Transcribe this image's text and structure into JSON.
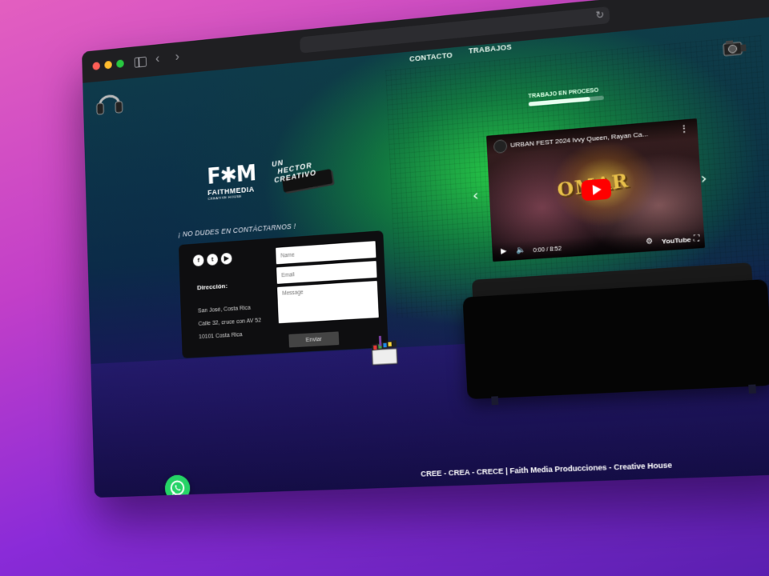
{
  "nav": {
    "contact": "CONTACTO",
    "works": "TRABAJOS"
  },
  "wip": {
    "label": "TRABAJO EN PROCESO",
    "progress": 0.82
  },
  "logos": {
    "faith_mark": "F✱M",
    "faith_name": "FAITHMEDIA",
    "faith_sub": "CREATIVE HOUSE",
    "hector": [
      "UN",
      "HECTOR",
      "CREATIVO"
    ]
  },
  "contact": {
    "heading": "¡ NO DUDES EN CONTÁCTARNOS !",
    "address_title": "Dirección:",
    "address_lines": [
      "San José, Costa Rica",
      "Calle 32, cruce con AV 52",
      "10101 Costa Rica"
    ],
    "name_placeholder": "Name",
    "email_placeholder": "Email",
    "message_placeholder": "Message",
    "send_label": "Enviar"
  },
  "social": {
    "facebook": "f",
    "twitter": "t",
    "youtube": "▶"
  },
  "video": {
    "title": "URBAN FEST 2024 Ivvy Queen, Rayan Ca...",
    "overlay": "OMAR",
    "time": "0:00 / 8:52",
    "brand": "YouTube"
  },
  "footer": {
    "tagline": "CREE - CREA - CRECE | Faith Media Producciones - Creative House"
  },
  "colors": {
    "accent_green": "#28d24a",
    "whatsapp": "#25d366",
    "youtube_red": "#ff0000"
  }
}
